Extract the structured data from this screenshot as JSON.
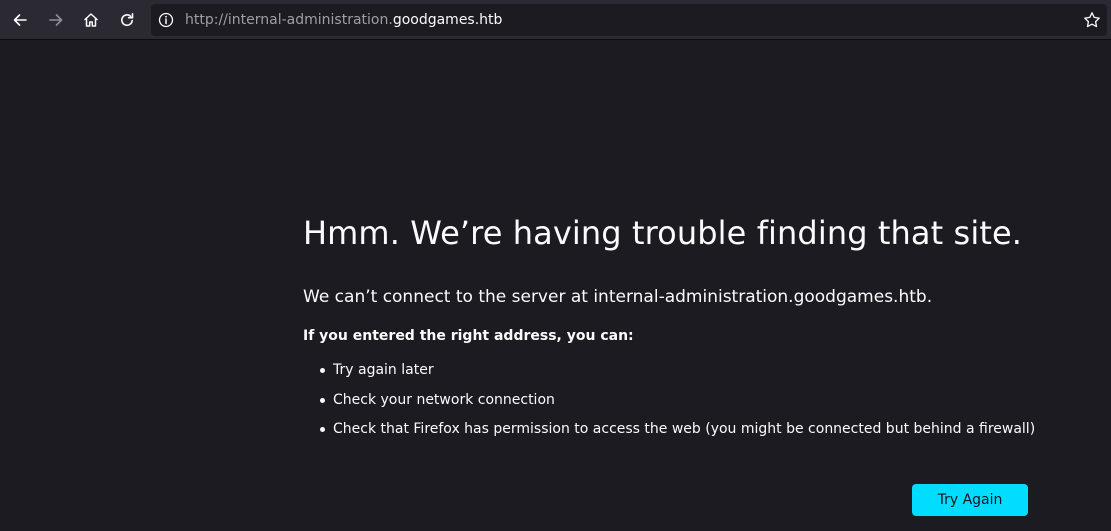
{
  "browser": {
    "url_prefix": "http://internal-administration.",
    "url_domain": "goodgames.htb",
    "icons": {
      "back": "arrow-left-icon",
      "forward": "arrow-right-icon",
      "home": "home-icon",
      "reload": "reload-icon",
      "site_info": "info-icon",
      "bookmark": "star-icon"
    }
  },
  "error_page": {
    "title": "Hmm. We’re having trouble finding that site.",
    "description": "We can’t connect to the server at internal-administration.goodgames.htb.",
    "subheading": "If you entered the right address, you can:",
    "suggestions": [
      "Try again later",
      "Check your network connection",
      "Check that Firefox has permission to access the web (you might be connected but behind a firewall)"
    ],
    "try_again_label": "Try Again"
  },
  "colors": {
    "background": "#1c1b22",
    "toolbar": "#2b2a33",
    "text": "#fbfbfe",
    "accent_button": "#00ddff"
  }
}
